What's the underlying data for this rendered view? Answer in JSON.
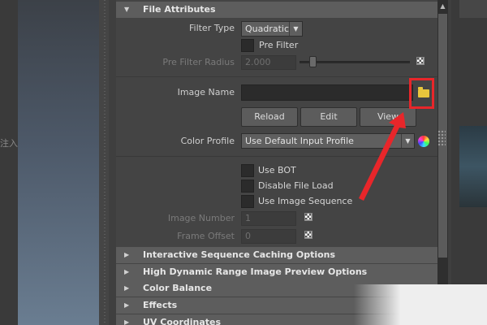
{
  "background": {
    "left_hint": "注入"
  },
  "sections": {
    "file_attributes": "File Attributes",
    "interactive_caching": "Interactive Sequence Caching Options",
    "hdr_preview": "High Dynamic Range Image Preview Options",
    "color_balance": "Color Balance",
    "effects": "Effects",
    "uv_coordinates": "UV Coordinates"
  },
  "file_attributes": {
    "filter_type_label": "Filter Type",
    "filter_type_value": "Quadratic",
    "pre_filter_label": "Pre Filter",
    "pre_filter_radius_label": "Pre Filter Radius",
    "pre_filter_radius_value": "2.000",
    "image_name_label": "Image Name",
    "image_name_value": "",
    "reload_label": "Reload",
    "edit_label": "Edit",
    "view_label": "View",
    "color_profile_label": "Color Profile",
    "color_profile_value": "Use Default Input Profile",
    "use_bot_label": "Use BOT",
    "disable_file_load_label": "Disable File Load",
    "use_image_sequence_label": "Use Image Sequence",
    "image_number_label": "Image Number",
    "image_number_value": "1",
    "frame_offset_label": "Frame Offset",
    "frame_offset_value": "0"
  },
  "colors": {
    "annotation_red": "#e8262a",
    "folder_yellow": "#e8c63c"
  },
  "icons": [
    "folder-icon",
    "color-wheel-icon",
    "checker-icon",
    "expand-arrow-icon",
    "collapse-arrow-icon"
  ]
}
